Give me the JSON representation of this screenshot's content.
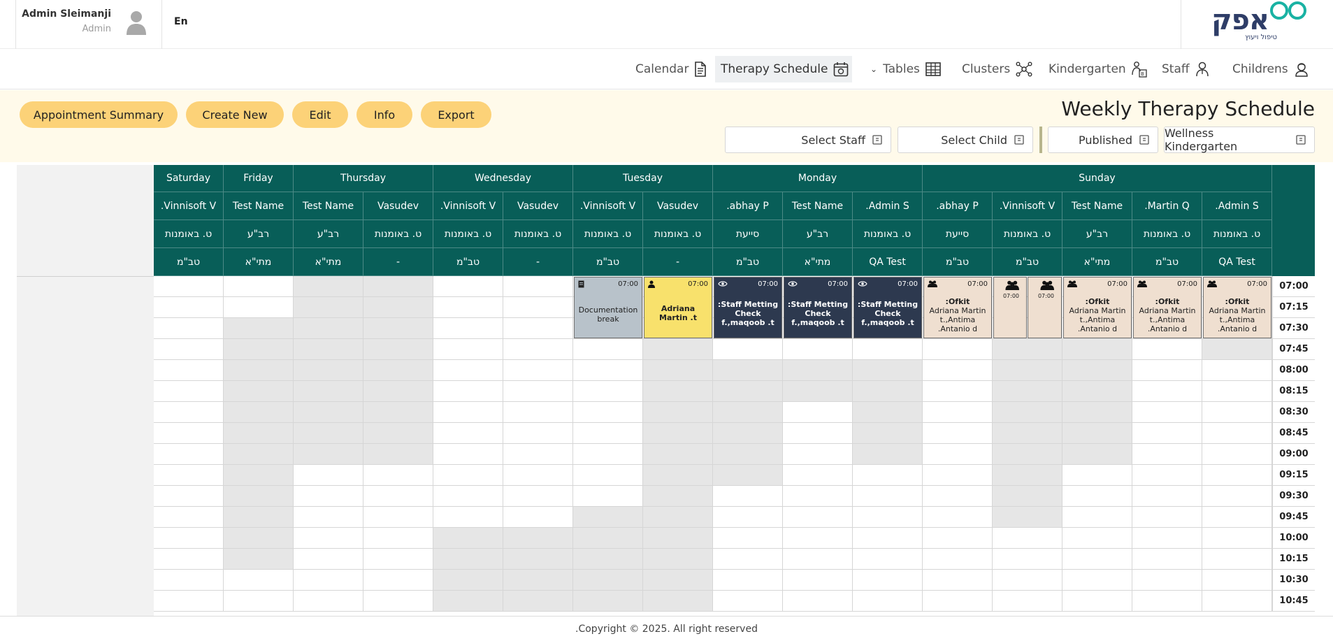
{
  "user": {
    "name": "Admin Sleimanji",
    "role": "Admin"
  },
  "language": "En",
  "logo": {
    "text": "אפק",
    "subtitle": "טיפול ויעוץ"
  },
  "nav": {
    "calendar": "Calendar",
    "therapy_schedule": "Therapy Schedule",
    "tables": "Tables",
    "clusters": "Clusters",
    "kindergarten": "Kindergarten",
    "staff": "Staff",
    "childrens": "Childrens"
  },
  "toolbar": {
    "appointment_summary": "Appointment Summary",
    "create_new": "Create New",
    "edit": "Edit",
    "info": "Info",
    "export": "Export"
  },
  "page_title": "Weekly Therapy Schedule",
  "filters": {
    "select_staff": "Select Staff",
    "select_child": "Select Child",
    "status": "Published",
    "kindergarten": "Wellness Kindergarten"
  },
  "schedule": {
    "days": [
      "Sunday",
      "Monday",
      "Tuesday",
      "Wednesday",
      "Thursday",
      "Friday",
      "Saturday"
    ],
    "columns": [
      {
        "day": "Sunday",
        "name": ".Admin S",
        "role": "ט. באומנות",
        "group": "QA Test"
      },
      {
        "day": "Sunday",
        "name": ".Martin Q",
        "role": "ט. באומנות",
        "group": "טב\"מ"
      },
      {
        "day": "Sunday",
        "name": "Test Name",
        "role": "רב\"ע",
        "group": "מתי\"א"
      },
      {
        "day": "Sunday",
        "name": ".Vinnisoft V",
        "role": "ט. באומנות",
        "group": "טב\"מ"
      },
      {
        "day": "Sunday",
        "name": ".abhay P",
        "role": "סייעת",
        "group": "טב\"מ"
      },
      {
        "day": "Monday",
        "name": ".Admin S",
        "role": "ט. באומנות",
        "group": "QA Test"
      },
      {
        "day": "Monday",
        "name": "Test Name",
        "role": "רב\"ע",
        "group": "מתי\"א"
      },
      {
        "day": "Monday",
        "name": ".abhay P",
        "role": "סייעת",
        "group": "טב\"מ"
      },
      {
        "day": "Tuesday",
        "name": "Vasudev",
        "role": "ט. באומנות",
        "group": "-"
      },
      {
        "day": "Tuesday",
        "name": ".Vinnisoft V",
        "role": "ט. באומנות",
        "group": "טב\"מ"
      },
      {
        "day": "Wednesday",
        "name": "Vasudev",
        "role": "ט. באומנות",
        "group": "-"
      },
      {
        "day": "Wednesday",
        "name": ".Vinnisoft V",
        "role": "ט. באומנות",
        "group": "טב\"מ"
      },
      {
        "day": "Thursday",
        "name": "Vasudev",
        "role": "ט. באומנות",
        "group": "-"
      },
      {
        "day": "Thursday",
        "name": "Test Name",
        "role": "רב\"ע",
        "group": "מתי\"א"
      },
      {
        "day": "Friday",
        "name": "Test Name",
        "role": "רב\"ע",
        "group": "מתי\"א"
      },
      {
        "day": "Saturday",
        "name": ".Vinnisoft V",
        "role": "ט. באומנות",
        "group": "טב\"מ"
      }
    ],
    "times": [
      "07:00",
      "07:15",
      "07:30",
      "07:45",
      "08:00",
      "08:15",
      "08:30",
      "08:45",
      "09:00",
      "09:15",
      "09:30",
      "09:45",
      "10:00",
      "10:15",
      "10:30",
      "10:45"
    ],
    "busy": [
      [
        0,
        3,
        3
      ],
      [
        2,
        3,
        8
      ],
      [
        3,
        3,
        11
      ],
      [
        5,
        4,
        8
      ],
      [
        6,
        4,
        5
      ],
      [
        7,
        4,
        9
      ],
      [
        8,
        3,
        15
      ],
      [
        9,
        11,
        15
      ],
      [
        10,
        12,
        15
      ],
      [
        11,
        12,
        15
      ],
      [
        12,
        0,
        8
      ],
      [
        13,
        0,
        8
      ],
      [
        14,
        2,
        13
      ]
    ],
    "appointments": [
      {
        "col": 0,
        "row": 0,
        "rows": 3,
        "style": "beige",
        "icon": "group-icon",
        "time": "07:00",
        "title": ":Ofkit",
        "text": "Adriana Martin t.,Antima .Antanio d"
      },
      {
        "col": 1,
        "row": 0,
        "rows": 3,
        "style": "beige",
        "icon": "group-icon",
        "time": "07:00",
        "title": ":Ofkit",
        "text": "Adriana Martin t.,Antima .Antanio d"
      },
      {
        "col": 2,
        "row": 0,
        "rows": 3,
        "style": "beige",
        "icon": "group-icon",
        "time": "07:00",
        "title": ":Ofkit",
        "text": "Adriana Martin t.,Antima .Antanio d"
      },
      {
        "col": 3,
        "row": 0,
        "rows": 3,
        "style": "beige",
        "icon": "group-icon",
        "time": "07:00",
        "title": "",
        "text": "",
        "half": "right"
      },
      {
        "col": 3,
        "row": 0,
        "rows": 3,
        "style": "beige",
        "icon": "group-icon",
        "time": "07:00",
        "title": "",
        "text": "",
        "half": "left"
      },
      {
        "col": 4,
        "row": 0,
        "rows": 3,
        "style": "beige",
        "icon": "group-icon",
        "time": "07:00",
        "title": ":Ofkit",
        "text": "Adriana Martin t.,Antima .Antanio d"
      },
      {
        "col": 5,
        "row": 0,
        "rows": 3,
        "style": "dark",
        "icon": "eye-icon",
        "time": "07:00",
        "title": ":Staff Metting Check f.,maqoob .t",
        "text": ""
      },
      {
        "col": 6,
        "row": 0,
        "rows": 3,
        "style": "dark",
        "icon": "eye-icon",
        "time": "07:00",
        "title": ":Staff Metting Check f.,maqoob .t",
        "text": ""
      },
      {
        "col": 7,
        "row": 0,
        "rows": 3,
        "style": "dark",
        "icon": "eye-icon",
        "time": "07:00",
        "title": ":Staff Metting Check f.,maqoob .t",
        "text": ""
      },
      {
        "col": 8,
        "row": 0,
        "rows": 3,
        "style": "yellow",
        "icon": "person-icon",
        "time": "07:00",
        "title": "Adriana Martin .t",
        "text": ""
      },
      {
        "col": 9,
        "row": 0,
        "rows": 3,
        "style": "grey",
        "icon": "document-icon",
        "time": "07:00",
        "title": "",
        "text": "Documentation break"
      }
    ]
  },
  "footer": ".Copyright © 2025. All right reserved"
}
